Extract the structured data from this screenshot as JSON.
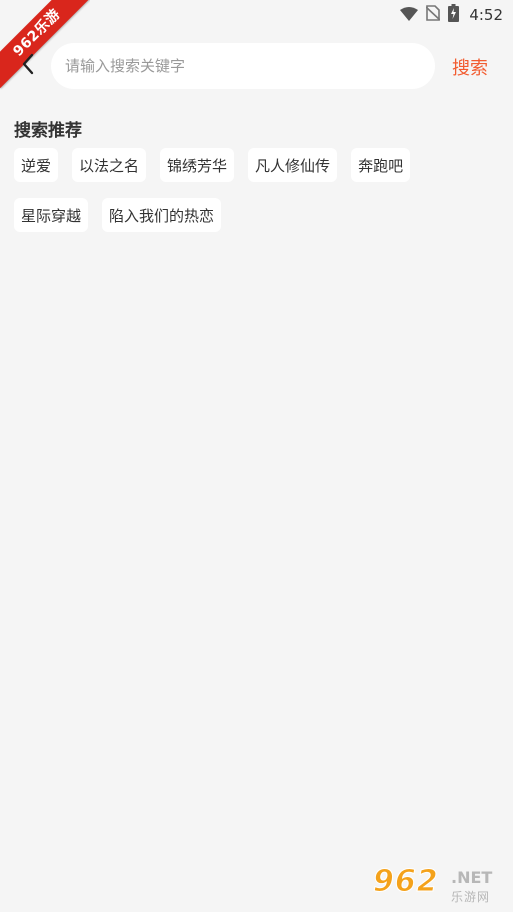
{
  "status_bar": {
    "time": "4:52",
    "icons": [
      "wifi-icon",
      "no-sim-icon",
      "battery-charging-icon"
    ]
  },
  "watermark": {
    "ribbon_text": "962乐游",
    "brand_number": "962",
    "brand_suffix": ".NET",
    "brand_sub": "乐游网"
  },
  "search": {
    "placeholder": "请输入搜索关键字",
    "value": "",
    "button_label": "搜索"
  },
  "recommendations": {
    "title": "搜索推荐",
    "tags": [
      "逆爱",
      "以法之名",
      "锦绣芳华",
      "凡人修仙传",
      "奔跑吧",
      "星际穿越",
      "陷入我们的热恋"
    ]
  },
  "colors": {
    "accent": "#f25c30",
    "background": "#f5f5f5",
    "tag_background": "#ffffff",
    "ribbon": "#d9261c"
  }
}
